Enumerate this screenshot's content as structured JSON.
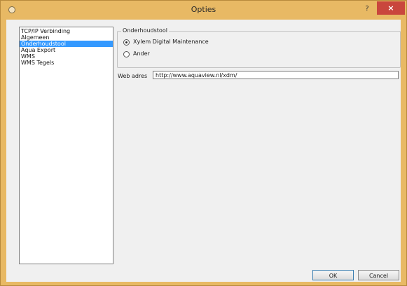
{
  "window": {
    "title": "Opties",
    "help_label": "?",
    "close_label": "×",
    "accent_color": "#e8b964",
    "close_color": "#c9463d"
  },
  "nav": {
    "items": [
      {
        "label": "TCP/IP Verbinding",
        "selected": false
      },
      {
        "label": "Algemeen",
        "selected": false
      },
      {
        "label": "Onderhoudstool",
        "selected": true
      },
      {
        "label": "Aqua Export",
        "selected": false
      },
      {
        "label": "WMS",
        "selected": false
      },
      {
        "label": "WMS Tegels",
        "selected": false
      }
    ]
  },
  "maintenance_group": {
    "title": "Onderhoudstool",
    "options": [
      {
        "label": "Xylem Digital Maintenance",
        "checked": true
      },
      {
        "label": "Ander",
        "checked": false
      }
    ]
  },
  "web_address": {
    "label": "Web adres",
    "value": "http://www.aquaview.nl/xdm/"
  },
  "buttons": {
    "ok": "OK",
    "cancel": "Cancel"
  }
}
